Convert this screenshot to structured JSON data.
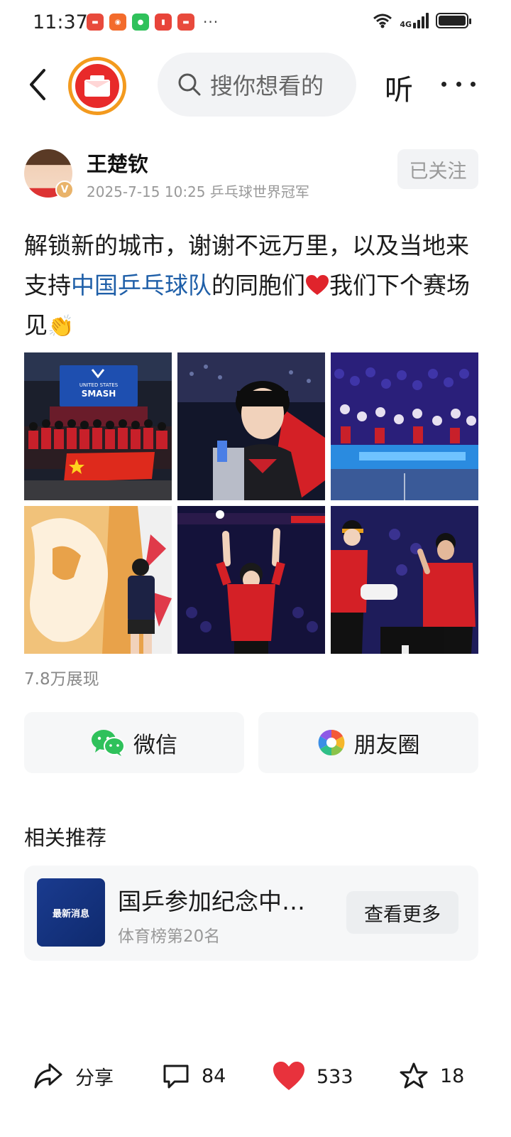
{
  "status_bar": {
    "time": "11:37",
    "network": "4G",
    "more": "···"
  },
  "nav": {
    "search_placeholder": "搜你想看的",
    "listen_label": "听"
  },
  "author": {
    "name": "王楚钦",
    "meta": "2025-7-15 10:25  乒乓球世界冠军",
    "verified_badge": "V",
    "follow_label": "已关注"
  },
  "post": {
    "text_part1": "解锁新的城市，谢谢不远万里，以及当地来支持",
    "topic": "中国乒乓球队",
    "text_part2": "的同胞们",
    "text_part3": "我们下个赛场见",
    "emoji_clap": "👏"
  },
  "gallery": {
    "banner_text_1": "UNITED STATES",
    "banner_text_2": "SMASH"
  },
  "impressions": "7.8万展现",
  "share": {
    "wechat_label": "微信",
    "moments_label": "朋友圈"
  },
  "related": {
    "title": "相关推荐",
    "thumb_label": "最新消息",
    "headline": "国乒参加纪念中…",
    "sub": "体育榜第20名",
    "more_label": "查看更多"
  },
  "actions": {
    "share_label": "分享",
    "comments": "84",
    "likes": "533",
    "favorites": "18"
  },
  "colors": {
    "accent_blue": "#1f5fa8",
    "like_red": "#e8323c",
    "logo_orange": "#f39a1e",
    "wechat_green": "#2fc15b"
  }
}
